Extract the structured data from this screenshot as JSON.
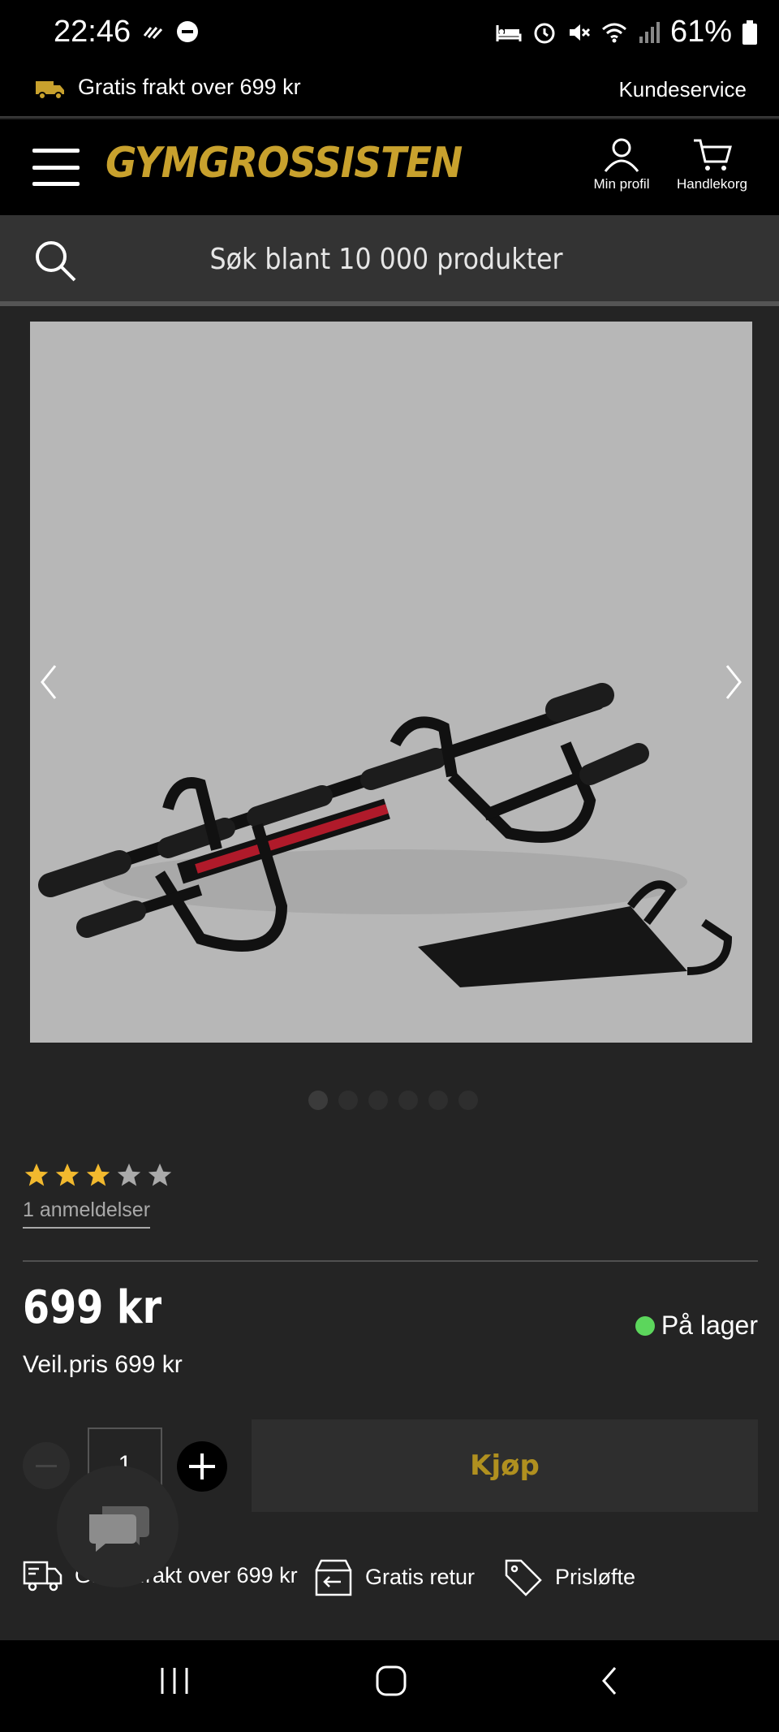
{
  "status_bar": {
    "time": "22:46",
    "battery": "61%",
    "icons": [
      "activity-icon",
      "dnd-icon",
      "bed-icon",
      "alarm-icon",
      "mute-icon",
      "wifi-icon",
      "signal-icon",
      "battery-icon"
    ]
  },
  "promo": {
    "shipping_text": "Gratis frakt over 699 kr",
    "customer_service": "Kundeservice"
  },
  "header": {
    "logo": "GYMGROSSISTEN",
    "profile_label": "Min profil",
    "cart_label": "Handlekorg",
    "accent_color": "#c8a12d"
  },
  "search": {
    "placeholder": "Søk blant 10 000 produkter"
  },
  "gallery": {
    "image_count": 6,
    "active_index": 0
  },
  "product": {
    "rating": 3,
    "rating_max": 5,
    "reviews": "1 anmeldelser",
    "price": "699 kr",
    "recommended_price": "Veil.pris 699 kr",
    "stock_status": "På lager",
    "stock_color": "#5cd65c",
    "quantity": "1",
    "buy_label": "Kjøp"
  },
  "usps": [
    {
      "icon": "truck-icon",
      "label": "Gratis frakt over 699 kr"
    },
    {
      "icon": "return-box-icon",
      "label": "Gratis retur"
    },
    {
      "icon": "price-tag-icon",
      "label": "Prisløfte"
    }
  ]
}
